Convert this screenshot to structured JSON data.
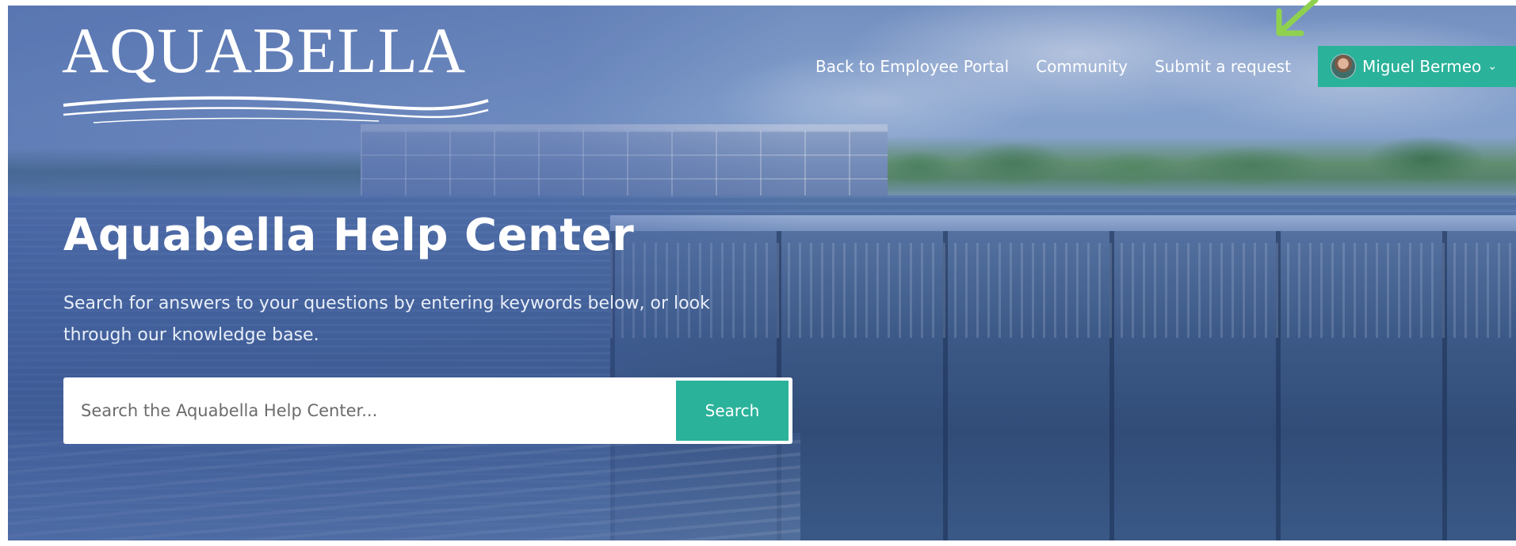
{
  "brand": {
    "logo_text": "AQUABELLA"
  },
  "nav": {
    "links": [
      {
        "label": "Back to Employee Portal"
      },
      {
        "label": "Community"
      },
      {
        "label": "Submit a request"
      }
    ],
    "user_name": "Miguel Bermeo",
    "user_caret": "⌄"
  },
  "hero": {
    "title": "Aquabella Help Center",
    "description": "Search for answers to your questions by entering keywords below, or look through our knowledge base."
  },
  "search": {
    "placeholder": "Search the Aquabella Help Center...",
    "button_label": "Search"
  },
  "colors": {
    "accent": "#2bb29a",
    "annotation_arrow": "#8fd14f"
  },
  "icons": {
    "user": "avatar",
    "dropdown": "chevron-down-icon",
    "annotation": "arrow-annotation"
  }
}
